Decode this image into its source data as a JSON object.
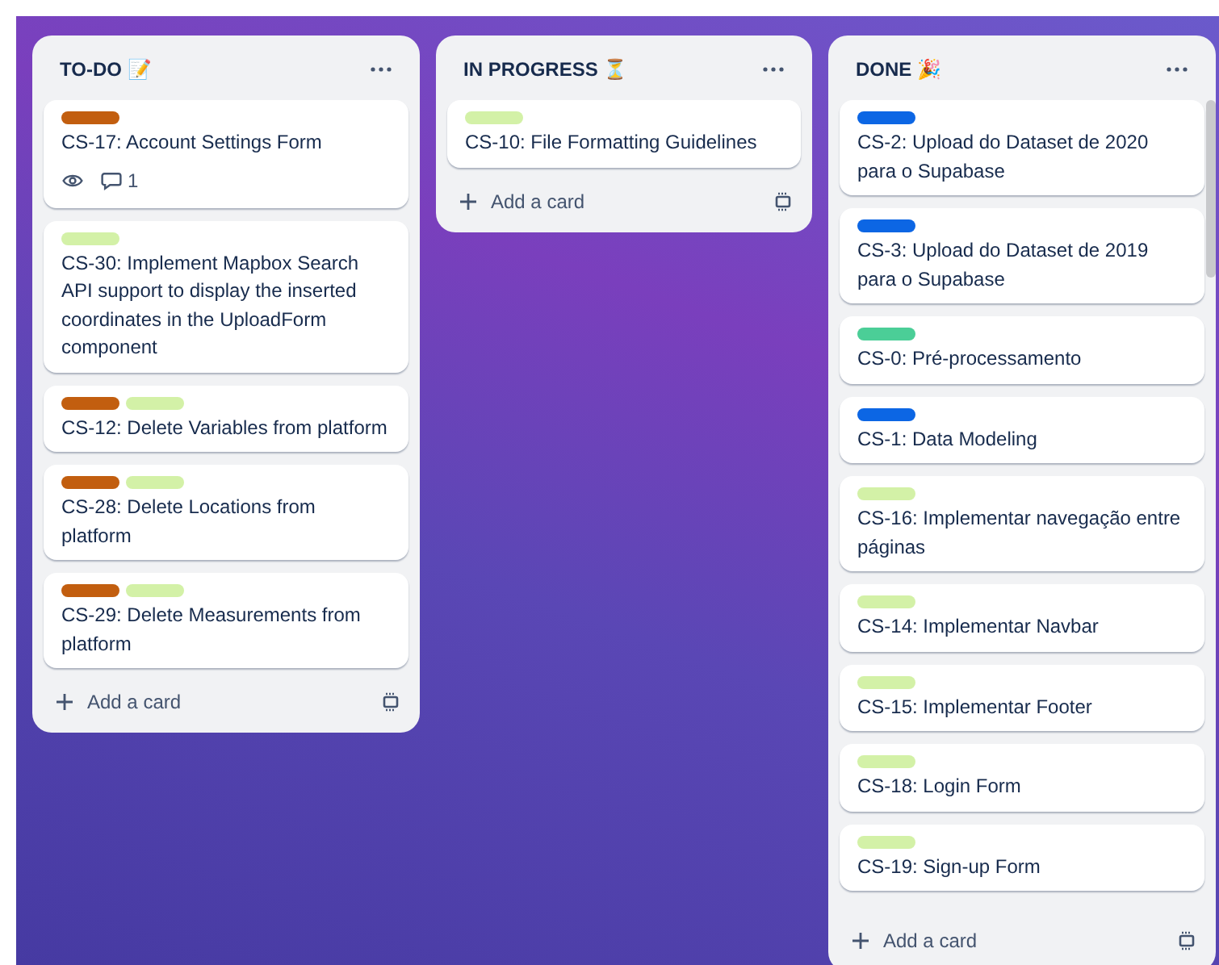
{
  "lists": [
    {
      "title": "TO-DO 📝",
      "cards": [
        {
          "labels": [
            {
              "color": "#c25e0f"
            }
          ],
          "title": "CS-17: Account Settings Form",
          "badges": {
            "watching": true,
            "comments": "1"
          }
        },
        {
          "labels": [
            {
              "color": "#d3f1a7"
            }
          ],
          "title": "CS-30: Implement Mapbox Search API support to display the inserted coordinates in the UploadForm component"
        },
        {
          "labels": [
            {
              "color": "#c25e0f"
            },
            {
              "color": "#d3f1a7"
            }
          ],
          "title": "CS-12: Delete Variables from platform"
        },
        {
          "labels": [
            {
              "color": "#c25e0f"
            },
            {
              "color": "#d3f1a7"
            }
          ],
          "title": "CS-28: Delete Locations from platform"
        },
        {
          "labels": [
            {
              "color": "#c25e0f"
            },
            {
              "color": "#d3f1a7"
            }
          ],
          "title": "CS-29: Delete Measurements from platform"
        }
      ],
      "add_card": "Add a card"
    },
    {
      "title": "IN PROGRESS ⏳",
      "cards": [
        {
          "labels": [
            {
              "color": "#d3f1a7"
            }
          ],
          "title": "CS-10: File Formatting Guidelines"
        }
      ],
      "add_card": "Add a card"
    },
    {
      "title": "DONE 🎉",
      "cards": [
        {
          "labels": [
            {
              "color": "#0c66e4"
            }
          ],
          "title": "CS-2: Upload do Dataset de 2020 para o Supabase"
        },
        {
          "labels": [
            {
              "color": "#0c66e4"
            }
          ],
          "title": "CS-3: Upload do Dataset de 2019 para o Supabase"
        },
        {
          "labels": [
            {
              "color": "#4bce97"
            }
          ],
          "title": "CS-0: Pré-processamento"
        },
        {
          "labels": [
            {
              "color": "#0c66e4"
            }
          ],
          "title": "CS-1: Data Modeling"
        },
        {
          "labels": [
            {
              "color": "#d3f1a7"
            }
          ],
          "title": "CS-16: Implementar navegação entre páginas"
        },
        {
          "labels": [
            {
              "color": "#d3f1a7"
            }
          ],
          "title": "CS-14: Implementar Navbar"
        },
        {
          "labels": [
            {
              "color": "#d3f1a7"
            }
          ],
          "title": "CS-15: Implementar Footer"
        },
        {
          "labels": [
            {
              "color": "#d3f1a7"
            }
          ],
          "title": "CS-18: Login Form"
        },
        {
          "labels": [
            {
              "color": "#d3f1a7"
            }
          ],
          "title": "CS-19: Sign-up Form"
        }
      ],
      "add_card": "Add a card"
    }
  ]
}
